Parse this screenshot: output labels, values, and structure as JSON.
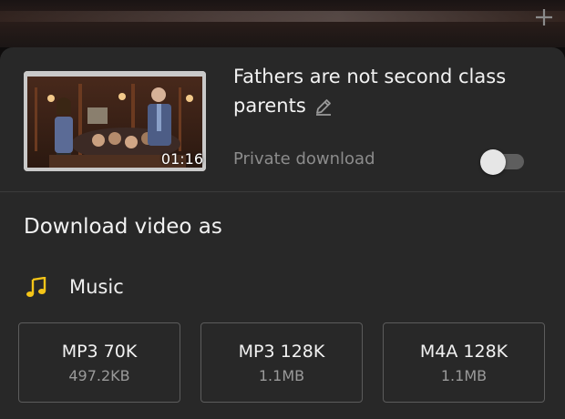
{
  "video": {
    "title": "Fathers are not second class parents",
    "duration": "01:16",
    "thumbnail_icon": "courtroom-thumbnail"
  },
  "private_download": {
    "label": "Private download",
    "enabled": false
  },
  "download_section": {
    "title": "Download video as"
  },
  "music": {
    "label": "Music",
    "icon": "music-note-icon",
    "accent_color": "#f5c518",
    "formats": [
      {
        "name": "MP3 70K",
        "size": "497.2KB"
      },
      {
        "name": "MP3 128K",
        "size": "1.1MB"
      },
      {
        "name": "M4A 128K",
        "size": "1.1MB"
      }
    ]
  },
  "icons": {
    "add": "plus-icon",
    "edit": "pencil-icon"
  }
}
